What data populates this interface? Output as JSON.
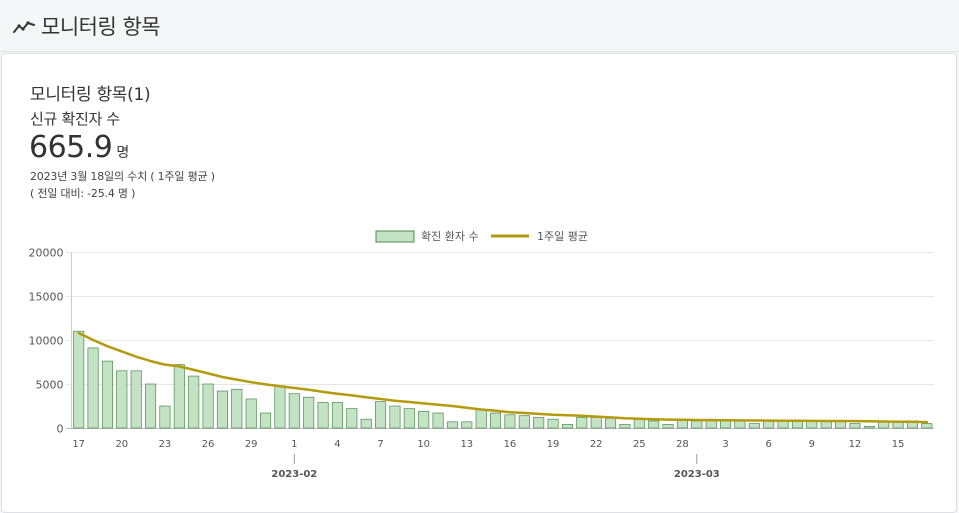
{
  "header": {
    "title": "모니터링 항목",
    "icon": "trend-line-icon"
  },
  "card": {
    "title": "모니터링 항목(1)",
    "metric_label": "신규 확진자 수",
    "metric_value": "665.9",
    "metric_unit": "명",
    "note_date": "2023년 3월 18일의 수치 ( 1주일 평균 )",
    "note_change": "( 전일 대비: -25.4 명 )"
  },
  "colors": {
    "bar_fill": "#c3e3c4",
    "bar_stroke": "#4c8a4f",
    "line": "#b39a0e"
  },
  "chart_data": {
    "type": "bar",
    "legend": [
      "확진 환자 수",
      "1주일 평균"
    ],
    "legend_position": "top",
    "ylim": [
      0,
      20000
    ],
    "yticks": [
      0,
      5000,
      10000,
      15000,
      20000
    ],
    "grid": true,
    "x_start": "2023-01-17",
    "x_end": "2023-03-18",
    "x_tick_labels": [
      "17",
      "20",
      "23",
      "26",
      "29",
      "1",
      "4",
      "7",
      "10",
      "13",
      "16",
      "19",
      "22",
      "25",
      "28",
      "3",
      "6",
      "9",
      "12",
      "15"
    ],
    "month_labels": [
      "2023-02",
      "2023-03"
    ],
    "series": [
      {
        "name": "확진 환자 수",
        "type": "bar",
        "values": [
          11000,
          9100,
          7600,
          6500,
          6500,
          5000,
          2500,
          7200,
          5900,
          5000,
          4200,
          4400,
          3300,
          1700,
          4800,
          3900,
          3500,
          2900,
          2900,
          2200,
          1000,
          3000,
          2500,
          2200,
          1900,
          1700,
          700,
          700,
          2100,
          1700,
          1500,
          1400,
          1200,
          1000,
          400,
          1200,
          1200,
          1100,
          400,
          1000,
          800,
          400,
          1000,
          800,
          1000,
          900,
          800,
          500,
          800,
          800,
          800,
          800,
          800,
          800,
          500,
          200,
          800,
          800,
          800,
          500
        ]
      },
      {
        "name": "1주일 평균",
        "type": "line",
        "values": [
          10800,
          10000,
          9300,
          8700,
          8100,
          7600,
          7200,
          7000,
          6600,
          6200,
          5800,
          5500,
          5200,
          4950,
          4750,
          4550,
          4350,
          4100,
          3900,
          3700,
          3500,
          3300,
          3100,
          2950,
          2800,
          2650,
          2500,
          2300,
          2100,
          1950,
          1800,
          1700,
          1600,
          1500,
          1450,
          1400,
          1300,
          1200,
          1100,
          1050,
          1000,
          950,
          930,
          910,
          890,
          870,
          860,
          850,
          840,
          830,
          820,
          810,
          800,
          790,
          780,
          760,
          740,
          720,
          700,
          666
        ]
      }
    ]
  }
}
